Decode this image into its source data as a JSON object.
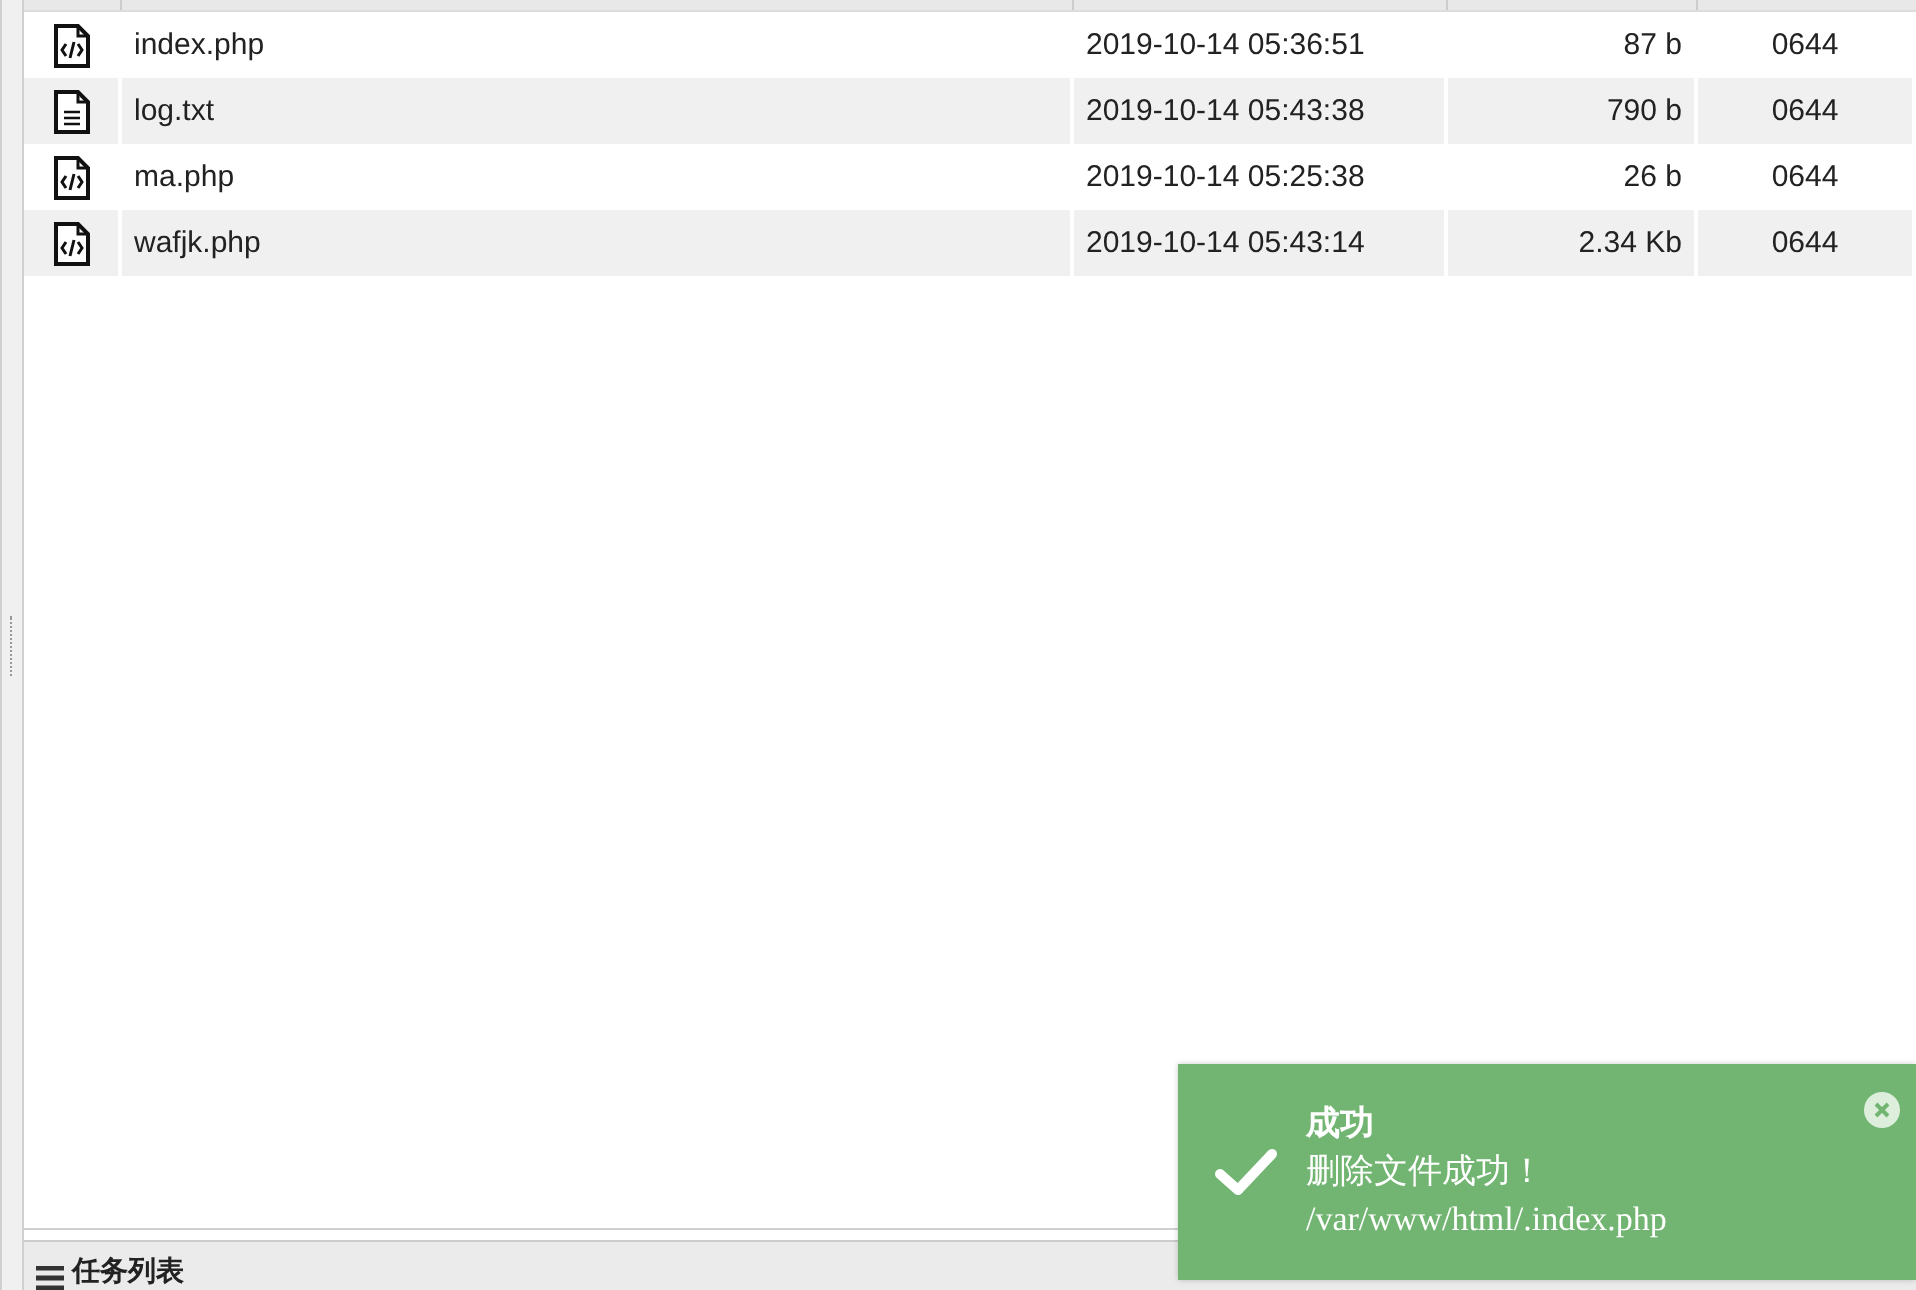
{
  "files": [
    {
      "kind": "code",
      "name": "index.php",
      "modified": "2019-10-14 05:36:51",
      "size": "87 b",
      "perms": "0644"
    },
    {
      "kind": "text",
      "name": "log.txt",
      "modified": "2019-10-14 05:43:38",
      "size": "790 b",
      "perms": "0644"
    },
    {
      "kind": "code",
      "name": "ma.php",
      "modified": "2019-10-14 05:25:38",
      "size": "26 b",
      "perms": "0644"
    },
    {
      "kind": "code",
      "name": "wafjk.php",
      "modified": "2019-10-14 05:43:14",
      "size": "2.34 Kb",
      "perms": "0644"
    }
  ],
  "task_panel": {
    "title": "任务列表"
  },
  "toast": {
    "title": "成功",
    "message": "删除文件成功！",
    "path": "/var/www/html/.index.php"
  }
}
